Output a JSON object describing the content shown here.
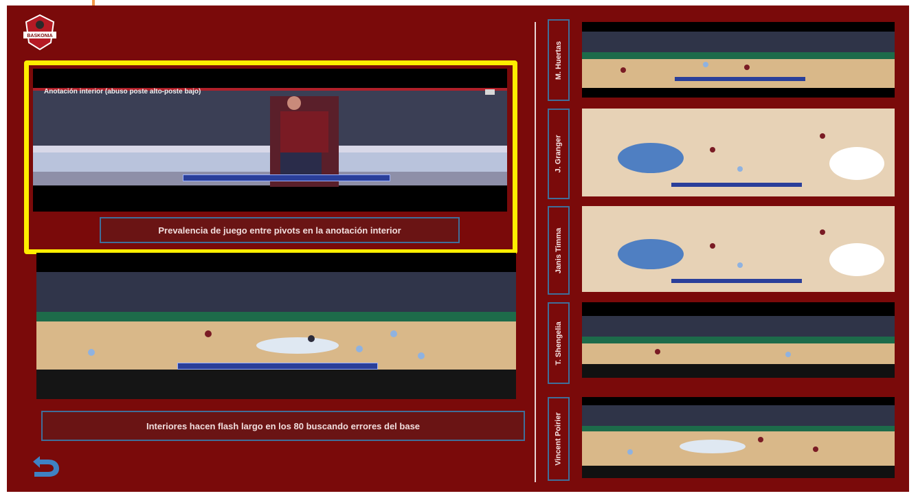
{
  "slide": {
    "background": "#7a0a0a",
    "logo": {
      "text": "BASKONIA",
      "icon": "baskonia-logo-icon"
    },
    "main_video": {
      "title": "Anotación interior (abuso poste alto-poste bajo)",
      "caption": "Prevalencia de juego entre pivots en la anotación interior"
    },
    "second_video": {
      "caption": "Interiores hacen flash largo en los 80 buscando errores del base"
    },
    "players": [
      {
        "name": "M. Huertas"
      },
      {
        "name": "J. Granger"
      },
      {
        "name": "Janis Timma"
      },
      {
        "name": "T. Shengelia"
      },
      {
        "name": "Vincent Poirier"
      }
    ],
    "back_icon": "back-arrow-icon",
    "colors": {
      "highlight": "#ffee00",
      "accent_line": "#f29a4a",
      "box_border": "#3f6f9a"
    }
  }
}
